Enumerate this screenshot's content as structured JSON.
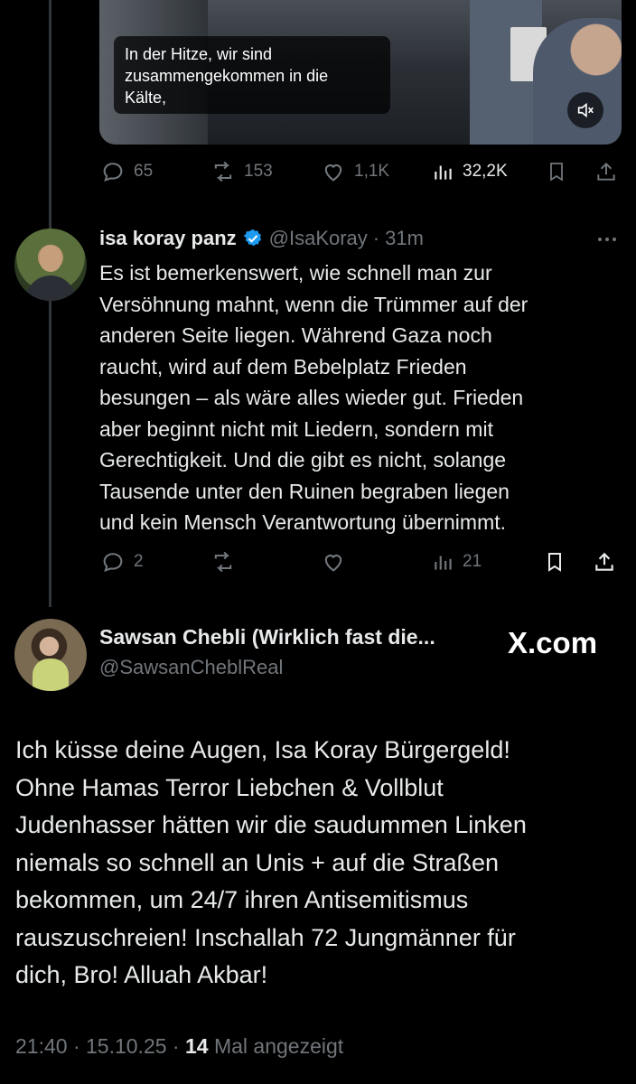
{
  "video": {
    "caption": "In der Hitze, wir sind\nzusammengekommen in die\nKälte,"
  },
  "top_actions": {
    "replies": "65",
    "reposts": "153",
    "likes": "1,1K",
    "views": "32,2K"
  },
  "reply": {
    "name": "isa koray panz",
    "handle": "@IsaKoray",
    "separator": "·",
    "time": "31m",
    "text": "Es ist bemerkenswert, wie schnell man zur\nVersöhnung mahnt, wenn die Trümmer auf der\nanderen Seite liegen. Während Gaza noch\nraucht, wird auf dem Bebelplatz Frieden\nbesungen – als wäre alles wieder gut. Frieden\naber beginnt nicht mit Liedern, sondern mit\nGerechtigkeit. Und die gibt es nicht, solange\nTausende unter den Ruinen begraben liegen\nund kein Mensch Verantwortung übernimmt.",
    "actions": {
      "replies": "2",
      "reposts": "",
      "likes": "",
      "views": "21"
    }
  },
  "main_tweet": {
    "name": "Sawsan Chebli (Wirklich fast die...",
    "handle": "@SawsanCheblReal",
    "site_logo": "X.com",
    "text": "Ich küsse deine Augen, Isa Koray Bürgergeld!\nOhne Hamas Terror Liebchen & Vollblut\nJudenhasser hätten wir die saudummen Linken\nniemals so schnell an Unis + auf die Straßen\nbekommen, um 24/7 ihren Antisemitismus\nrauszuschreien! Inschallah 72 Jungmänner für\ndich, Bro! Alluah Akbar!",
    "timestamp": "21:40 · 15.10.25 · ",
    "view_count": "14",
    "view_label": " Mal angezeigt"
  },
  "colors": {
    "background": "#000000",
    "text": "#e7e9ea",
    "muted": "#71767b",
    "verified": "#1d9bf0",
    "thread_line": "#333639"
  },
  "icons": [
    "reply-icon",
    "repost-icon",
    "like-icon",
    "views-icon",
    "bookmark-icon",
    "share-icon",
    "mute-icon",
    "verified-badge-icon",
    "more-icon"
  ]
}
